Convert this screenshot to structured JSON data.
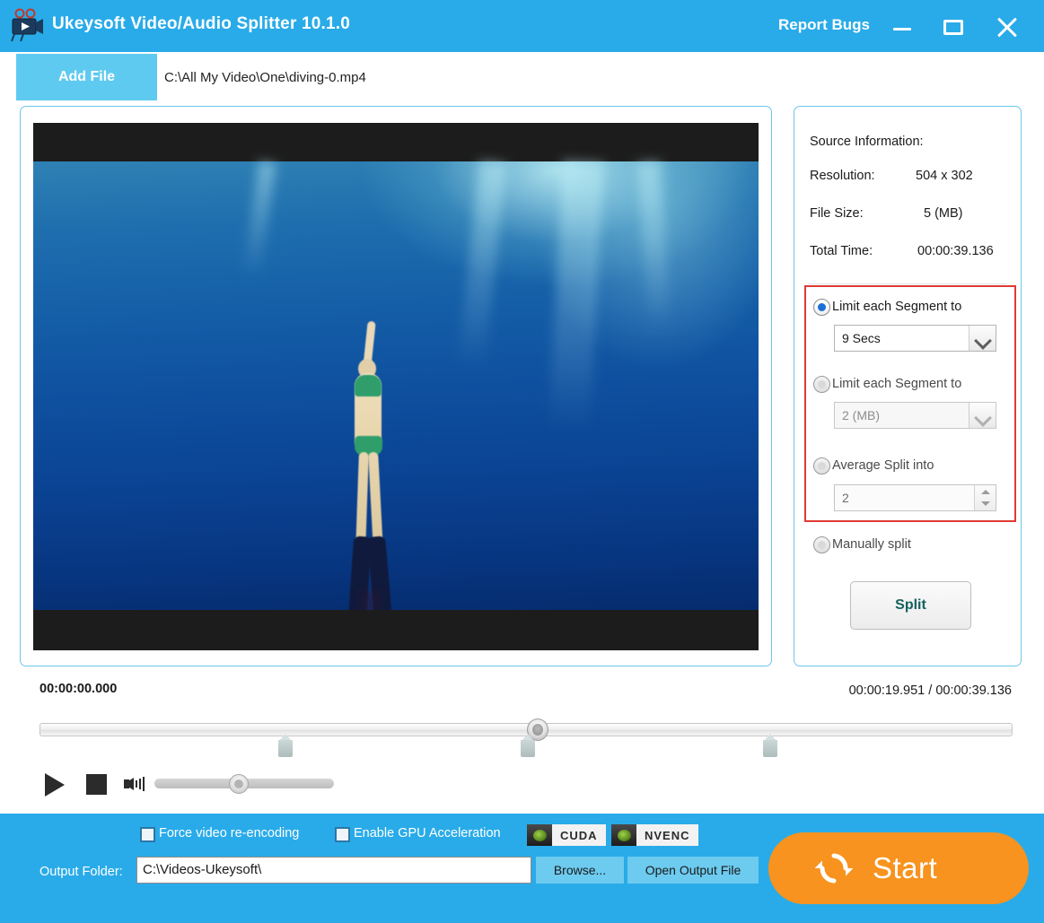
{
  "window": {
    "title": "Ukeysoft Video/Audio Splitter 10.1.0",
    "app_icon": "movie-camera-icon",
    "report_bugs": "Report Bugs",
    "minimize": "minimize-icon",
    "maximize": "maximize-icon",
    "close": "close-icon",
    "titlebar_color": "#29ABE9"
  },
  "toolbar": {
    "add_file_label": "Add File",
    "file_path": "C:\\All My Video\\One\\diving-0.mp4"
  },
  "preview": {
    "scene": "underwater freediver descending"
  },
  "source_info": {
    "heading": "Source Information:",
    "rows": [
      {
        "label": "Resolution:",
        "value": "504 x 302"
      },
      {
        "label": "File Size:",
        "value": "5 (MB)"
      },
      {
        "label": "Total Time:",
        "value": "00:00:39.136"
      }
    ]
  },
  "split_options": {
    "highlight_color": "#E03A33",
    "option1": {
      "label": "Limit each Segment to",
      "selected": true,
      "combo_value": "9 Secs"
    },
    "option2": {
      "label": "Limit each Segment to",
      "selected": false,
      "combo_value": "2 (MB)"
    },
    "option3": {
      "label": "Average Split into",
      "selected": false,
      "spin_value": "2"
    },
    "option4": {
      "label": "Manually split",
      "selected": false
    },
    "split_button": "Split"
  },
  "timeline": {
    "start_time": "00:00:00.000",
    "current_total": "00:00:19.951 / 00:00:39.136",
    "playhead_percent": 51,
    "markers_percent": [
      25,
      50,
      75
    ]
  },
  "playback": {
    "play": "play-icon",
    "stop": "stop-icon",
    "volume": "volume-icon",
    "volume_percent": 42
  },
  "bottom": {
    "force_reencode_label": "Force video re-encoding",
    "force_reencode_checked": false,
    "gpu_accel_label": "Enable GPU Acceleration",
    "gpu_accel_checked": false,
    "badges": [
      {
        "name": "CUDA",
        "icon": "nvidia-eye-icon"
      },
      {
        "name": "NVENC",
        "icon": "nvidia-eye-icon"
      }
    ],
    "output_folder_label": "Output Folder:",
    "output_folder_value": "C:\\Videos-Ukeysoft\\",
    "browse_label": "Browse...",
    "open_output_label": "Open Output File",
    "start_label": "Start",
    "start_color": "#F7931E",
    "start_icon": "refresh-icon"
  }
}
